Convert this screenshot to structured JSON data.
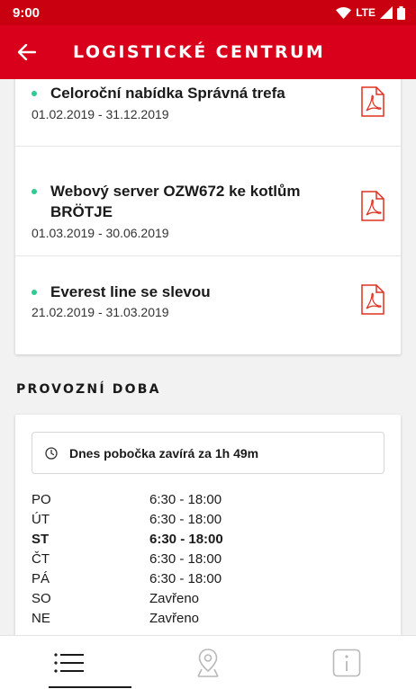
{
  "status_bar": {
    "time": "9:00",
    "network": "LTE"
  },
  "app_bar": {
    "title": "LOGISTICKÉ CENTRUM"
  },
  "offers": [
    {
      "name": "Celoroční nabídka Správná trefa",
      "dates": "01.02.2019 - 31.12.2019"
    },
    {
      "name": "Webový server OZW672 ke kotlům BRÖTJE",
      "dates": "01.03.2019 - 30.06.2019"
    },
    {
      "name": "Everest line se slevou",
      "dates": "21.02.2019 - 31.03.2019"
    }
  ],
  "opening_hours": {
    "title": "PROVOZNÍ DOBA",
    "closing_notice": "Dnes pobočka zavírá za 1h 49m",
    "days": [
      {
        "day": "PO",
        "time": "6:30 - 18:00"
      },
      {
        "day": "ÚT",
        "time": "6:30 - 18:00"
      },
      {
        "day": "ST",
        "time": "6:30 - 18:00"
      },
      {
        "day": "ČT",
        "time": "6:30 - 18:00"
      },
      {
        "day": "PÁ",
        "time": "6:30 - 18:00"
      },
      {
        "day": "SO",
        "time": "Zavřeno"
      },
      {
        "day": "NE",
        "time": "Zavřeno"
      }
    ],
    "today": "ST"
  },
  "bottom_nav": [
    {
      "icon": "list-icon",
      "active": true
    },
    {
      "icon": "map-pin-icon",
      "active": false
    },
    {
      "icon": "info-icon",
      "active": false
    }
  ],
  "colors": {
    "primary": "#d9001b",
    "status_bar": "#c8000f",
    "bullet": "#2ecc8f",
    "pdf_icon": "#e0301e"
  }
}
